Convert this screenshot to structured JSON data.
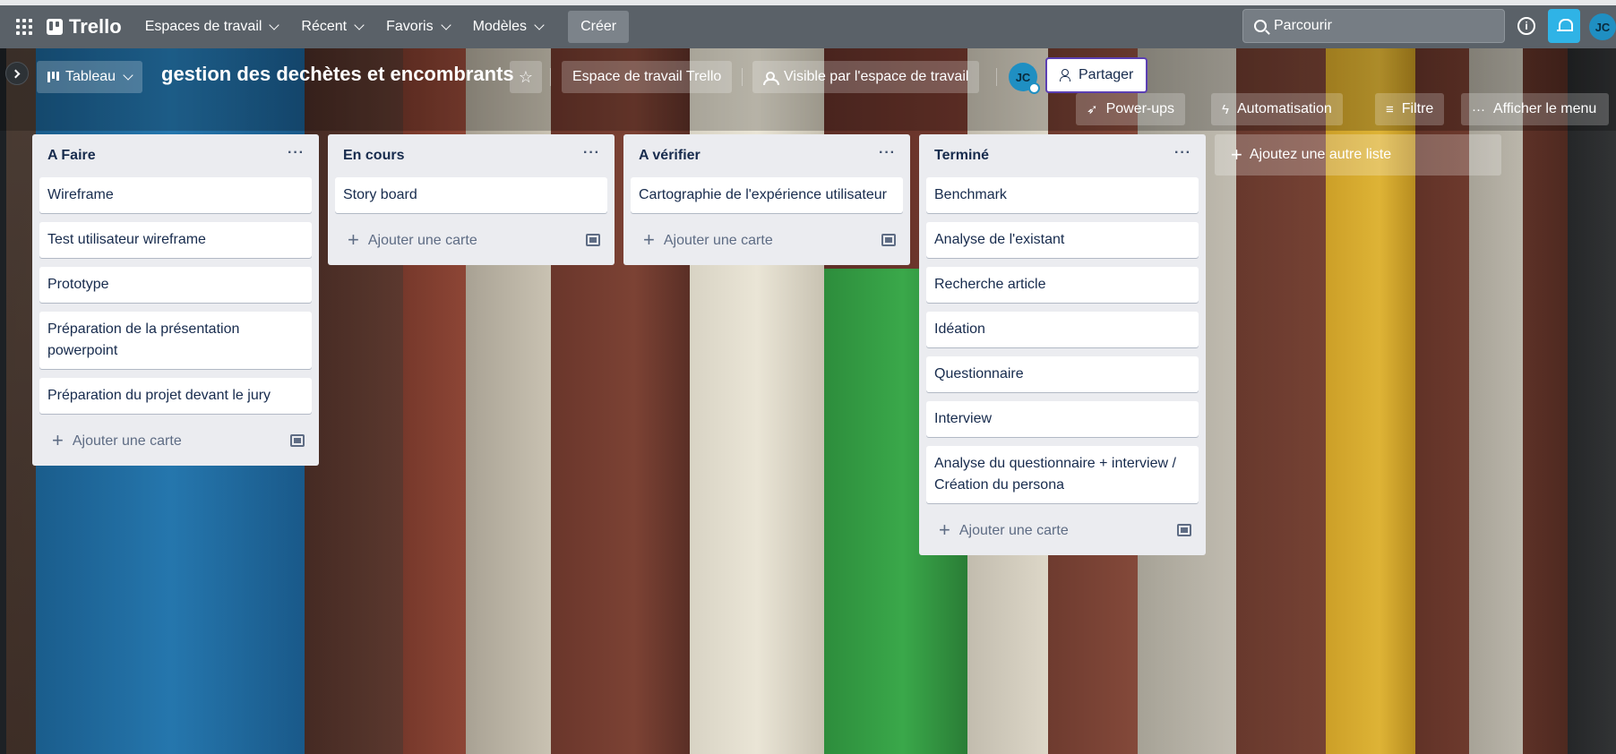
{
  "colors": {
    "topbar": "#5a6168",
    "list_bg": "#ebecf0",
    "card_bg": "#ffffff",
    "accent_blue": "#2fb3e6",
    "avatar": "#1f8fc2",
    "share_border": "#5b3fb3"
  },
  "topnav": {
    "apps_icon": "grid-icon",
    "logo": "Trello",
    "items": [
      {
        "label": "Espaces de travail"
      },
      {
        "label": "Récent"
      },
      {
        "label": "Favoris"
      },
      {
        "label": "Modèles"
      }
    ],
    "create_label": "Créer",
    "search_placeholder": "Parcourir",
    "info_icon": "info-icon",
    "notifications_icon": "bell-icon",
    "user_initials": "JC"
  },
  "board": {
    "view_label": "Tableau",
    "title": "gestion des dechètes et encombrants",
    "workspace_label": "Espace de travail Trello",
    "visibility_label": "Visible par l'espace de travail",
    "member_initials": "JC",
    "share_label": "Partager",
    "powerups_label": "Power-ups",
    "automation_label": "Automatisation",
    "filter_label": "Filtre",
    "menu_label": "Afficher le menu"
  },
  "lists": [
    {
      "title": "A Faire",
      "cards": [
        "Wireframe",
        "Test utilisateur wireframe",
        "Prototype",
        "Préparation de la présentation powerpoint",
        "Préparation du projet devant le jury"
      ],
      "add_card_label": "Ajouter une carte"
    },
    {
      "title": "En cours",
      "cards": [
        "Story board"
      ],
      "add_card_label": "Ajouter une carte"
    },
    {
      "title": "A vérifier",
      "cards": [
        "Cartographie de l'expérience utilisateur"
      ],
      "add_card_label": "Ajouter une carte"
    },
    {
      "title": "Terminé",
      "cards": [
        "Benchmark",
        "Analyse de l'existant",
        "Recherche article",
        "Idéation",
        "Questionnaire",
        "Interview",
        "Analyse du questionnaire + interview / Création du persona"
      ],
      "add_card_label": "Ajouter une carte"
    }
  ],
  "add_list_label": "Ajoutez une autre liste"
}
